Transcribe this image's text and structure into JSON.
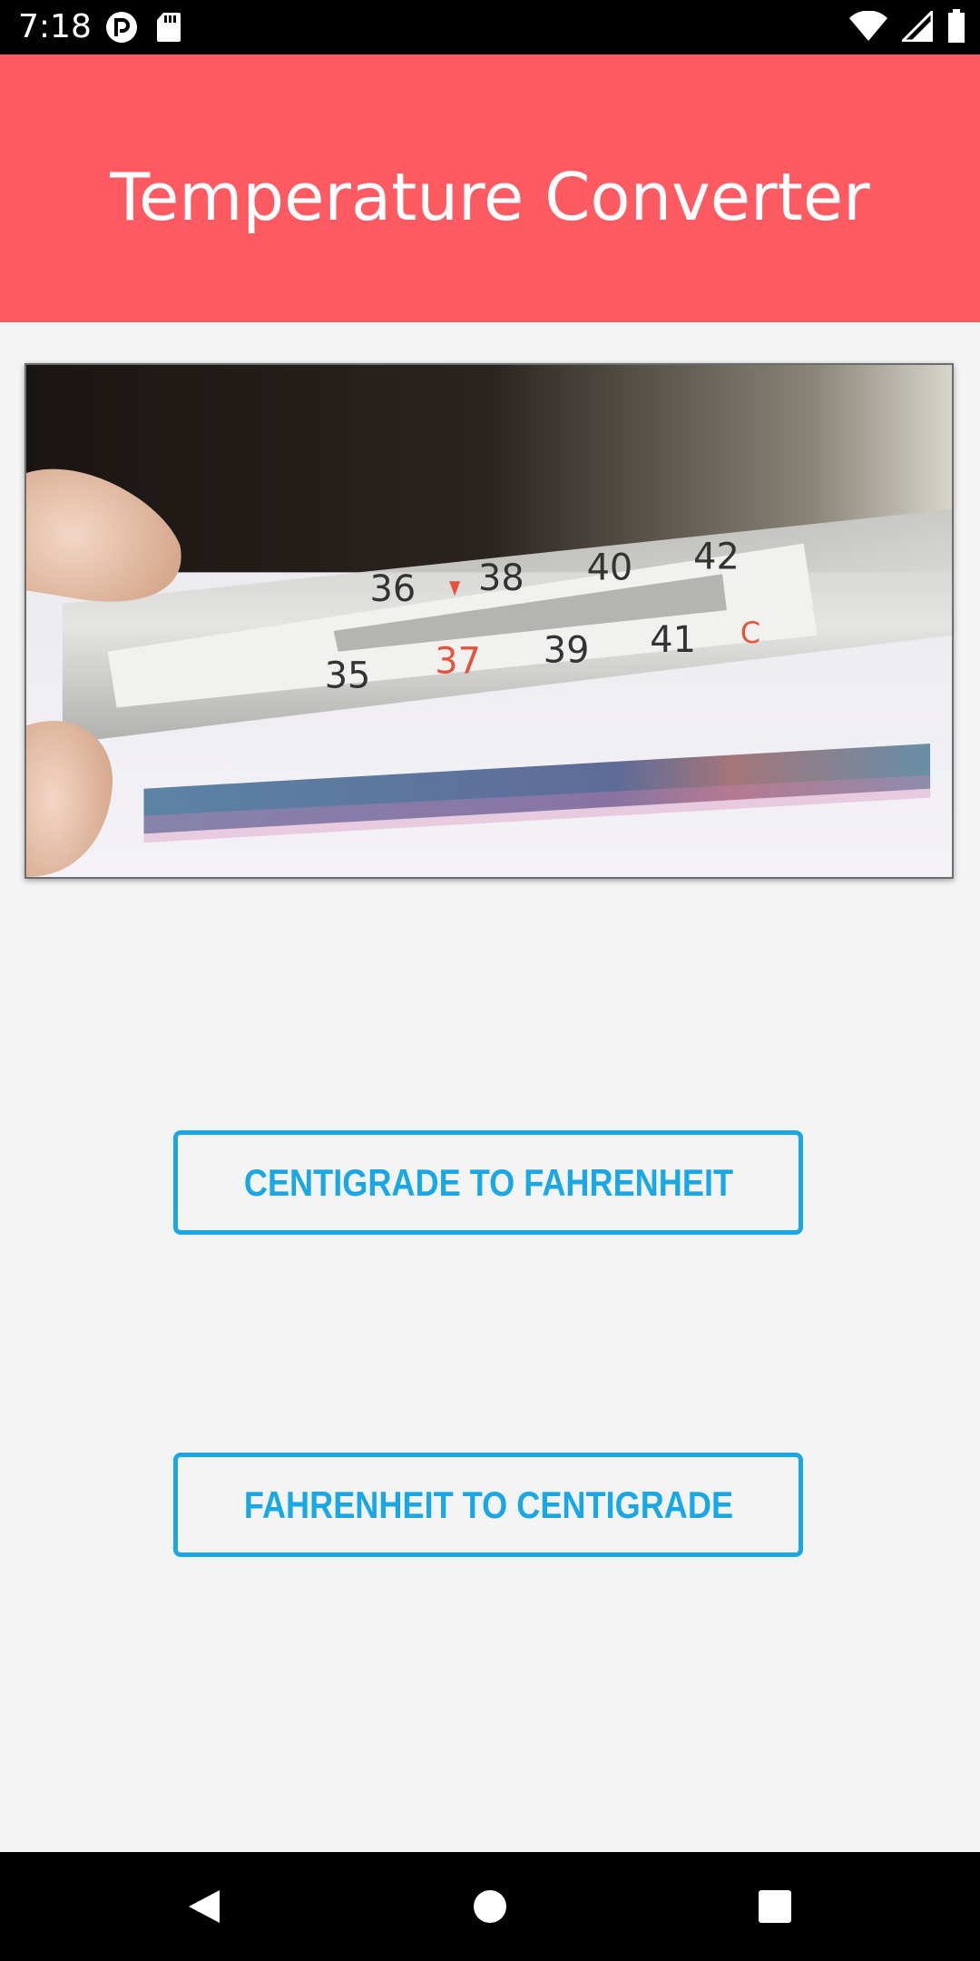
{
  "status_bar": {
    "time": "7:18",
    "icons": [
      "pocket-cast-icon",
      "sd-card-icon",
      "wifi-icon",
      "signal-icon",
      "battery-icon"
    ]
  },
  "app_bar": {
    "title": "Temperature Converter",
    "background_color": "#fd5a62"
  },
  "hero_image": {
    "description_icon": "thermometer-photo",
    "scale_labels_top": [
      "36",
      "38",
      "40",
      "42"
    ],
    "scale_labels_bottom": [
      "35",
      "37",
      "39",
      "41"
    ],
    "unit": "C"
  },
  "buttons": {
    "c_to_f_label": "CENTIGRADE TO FAHRENHEIT",
    "f_to_c_label": "FAHRENHEIT TO CENTIGRADE",
    "accent_color": "#19a8e5"
  },
  "nav_bar": {
    "icons": [
      "back-icon",
      "home-icon",
      "recents-icon"
    ]
  }
}
